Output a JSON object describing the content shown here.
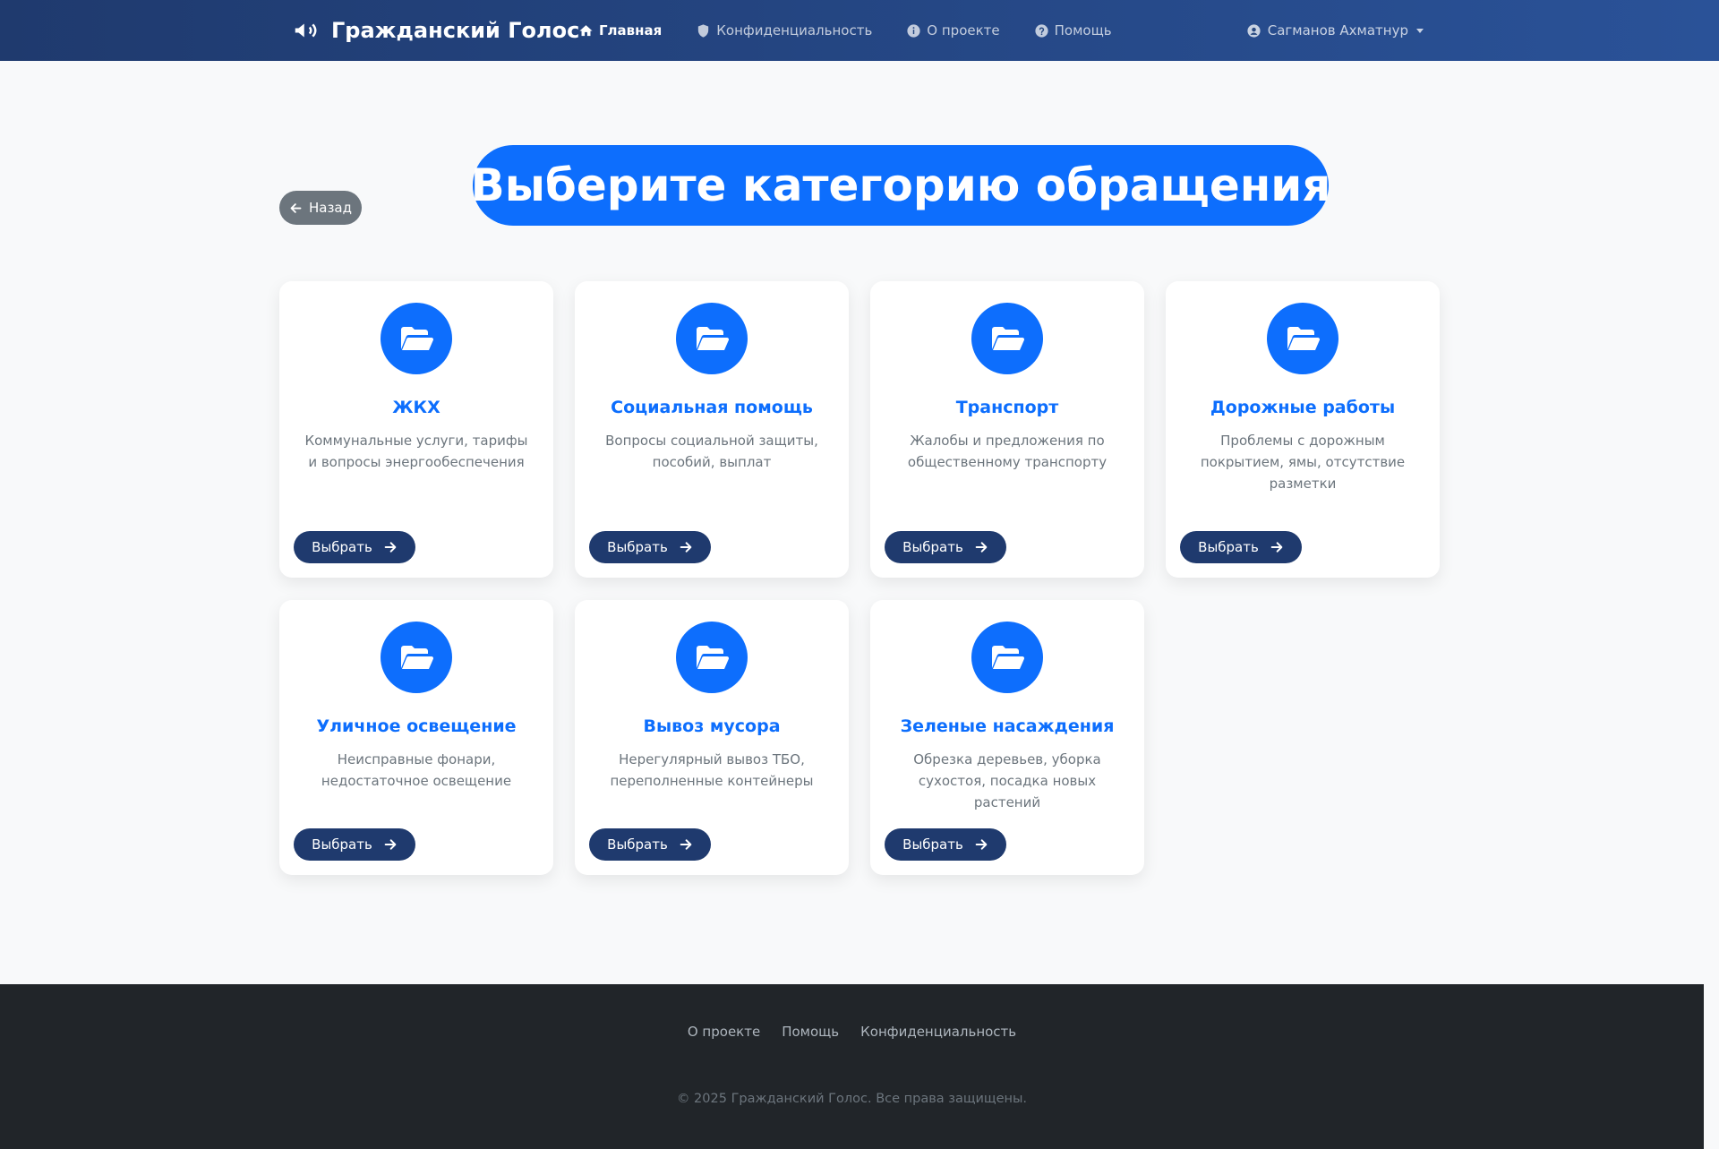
{
  "navbar": {
    "brand": "Гражданский Голос",
    "links": [
      {
        "label": "Главная",
        "icon": "home-icon",
        "active": true
      },
      {
        "label": "Конфиденциальность",
        "icon": "shield-icon"
      },
      {
        "label": "О проекте",
        "icon": "info-icon"
      },
      {
        "label": "Помощь",
        "icon": "question-icon"
      }
    ],
    "user_name": "Сагманов Ахматнур"
  },
  "page": {
    "back_label": "Назад",
    "title": "Выберите категорию обращения"
  },
  "categories": [
    {
      "title": "ЖКХ",
      "description": "Коммунальные услуги, тарифы и вопросы энергообеспечения",
      "button": "Выбрать"
    },
    {
      "title": "Социальная помощь",
      "description": "Вопросы социальной защиты, пособий, выплат",
      "button": "Выбрать"
    },
    {
      "title": "Транспорт",
      "description": "Жалобы и предложения по общественному транспорту",
      "button": "Выбрать"
    },
    {
      "title": "Дорожные работы",
      "description": "Проблемы с дорожным покрытием, ямы, отсутствие разметки",
      "button": "Выбрать"
    },
    {
      "title": "Уличное освещение",
      "description": "Неисправные фонари, недостаточное освещение",
      "button": "Выбрать"
    },
    {
      "title": "Вывоз мусора",
      "description": "Нерегулярный вывоз ТБО, переполненные контейнеры",
      "button": "Выбрать"
    },
    {
      "title": "Зеленые насаждения",
      "description": "Обрезка деревьев, уборка сухостоя, посадка новых растений",
      "button": "Выбрать"
    }
  ],
  "footer": {
    "links": [
      "О проекте",
      "Помощь",
      "Конфиденциальность"
    ],
    "copyright": "© 2025 Гражданский Голос. Все права защищены."
  },
  "colors": {
    "primary": "#0d6efd",
    "navy": "#1f3a6e",
    "footer": "#212529",
    "secondary": "#6c757d"
  }
}
